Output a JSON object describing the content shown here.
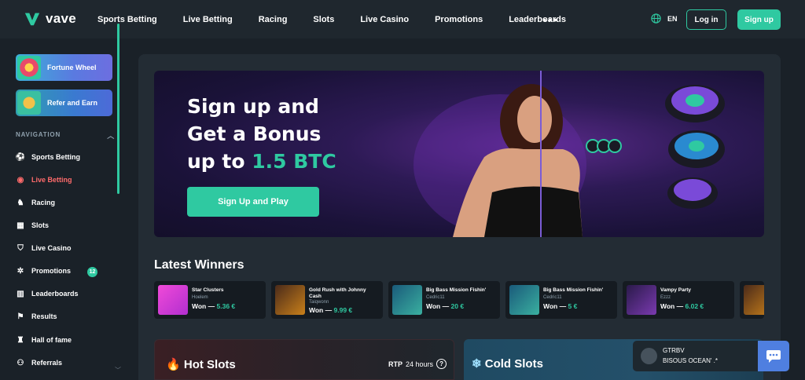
{
  "header": {
    "logo_text": "vave",
    "nav": [
      "Sports Betting",
      "Live Betting",
      "Racing",
      "Slots",
      "Live Casino",
      "Promotions",
      "Leaderboards"
    ],
    "more_label": "•••",
    "lang": "EN",
    "login_label": "Log in",
    "signup_label": "Sign up",
    "accent": "#2fc9a1"
  },
  "sidebar": {
    "promos": [
      {
        "label": "Fortune Wheel",
        "icon": "wheel-icon"
      },
      {
        "label": "Refer and Earn",
        "icon": "refer-icon"
      }
    ],
    "nav_heading": "NAVIGATION",
    "items": [
      {
        "label": "Sports Betting",
        "icon": "soccer-ball-icon"
      },
      {
        "label": "Live Betting",
        "icon": "live-signal-icon"
      },
      {
        "label": "Racing",
        "icon": "horse-icon"
      },
      {
        "label": "Slots",
        "icon": "slots-icon"
      },
      {
        "label": "Live Casino",
        "icon": "shield-icon"
      },
      {
        "label": "Promotions",
        "icon": "promotions-icon",
        "badge": "12"
      },
      {
        "label": "Leaderboards",
        "icon": "leaderboard-icon"
      },
      {
        "label": "Results",
        "icon": "flag-icon"
      },
      {
        "label": "Hall of fame",
        "icon": "trophy-icon"
      },
      {
        "label": "Referrals",
        "icon": "referrals-icon"
      }
    ]
  },
  "hero": {
    "line1": "Sign up and",
    "line2": "Get a Bonus",
    "line3_prefix": "up to ",
    "line3_highlight": "1.5 BTC",
    "button": "Sign Up and Play"
  },
  "winners": {
    "title": "Latest Winners",
    "won_label": "Won —",
    "items": [
      {
        "game": "Star Clusters",
        "user": "Hoelem",
        "amount": "5.36 €",
        "color": "#d63ad8"
      },
      {
        "game": "Gold Rush with Johnny Cash",
        "user": "Taiqwonn",
        "amount": "9.99 €",
        "color": "#8a5a1a"
      },
      {
        "game": "Big Bass Mission Fishin'",
        "user": "Cedric11",
        "amount": "20 €",
        "color": "#2a7a8a"
      },
      {
        "game": "Big Bass Mission Fishin'",
        "user": "Cedric11",
        "amount": "5 €",
        "color": "#2a7a8a"
      },
      {
        "game": "Vampy Party",
        "user": "Ezzz",
        "amount": "6.02 €",
        "color": "#4a2a6a"
      }
    ]
  },
  "hot_slots": {
    "title": "Hot Slots",
    "rtp_label": "RTP",
    "rtp_period": "24 hours",
    "help": "?"
  },
  "cold_slots": {
    "title": "Cold Slots"
  },
  "chat": {
    "name": "GTRBV",
    "message": "BISOUS OCEAN' .*"
  }
}
